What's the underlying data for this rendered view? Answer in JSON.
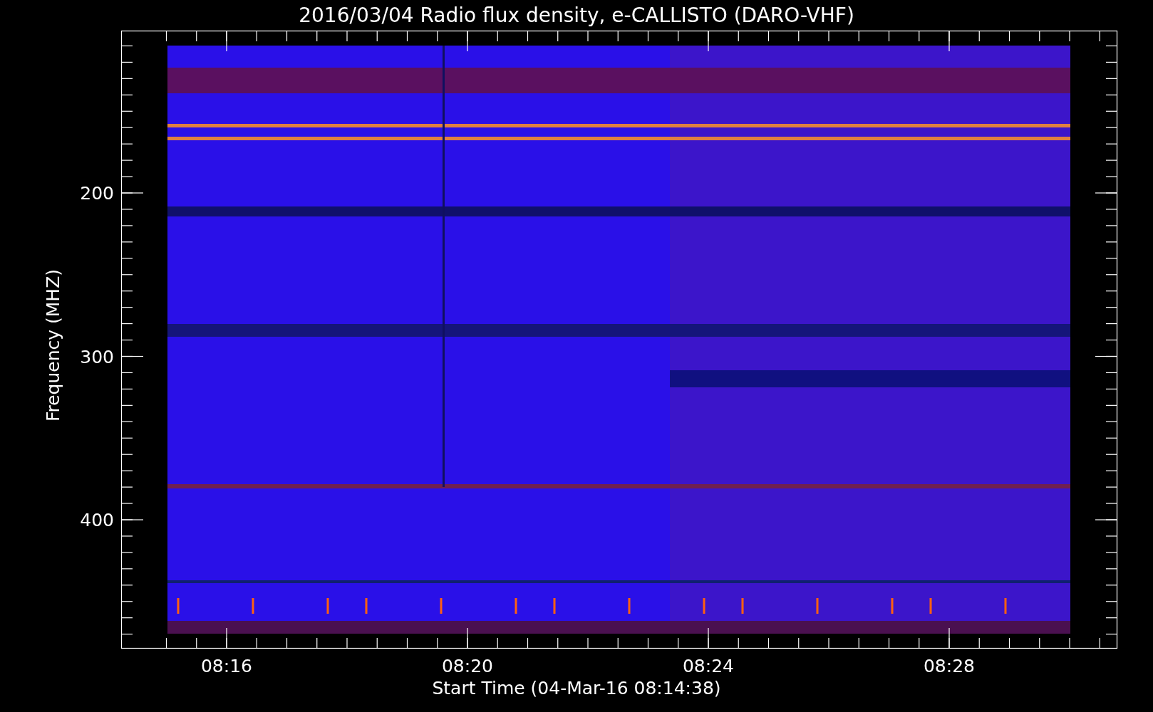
{
  "title": "2016/03/04  Radio flux density, e-CALLISTO (DARO-VHF)",
  "y_axis": {
    "label": "Frequency (MHZ)",
    "ticks": [
      "200",
      "300",
      "400"
    ]
  },
  "x_axis": {
    "label": "Start Time (04-Mar-16 08:14:38)",
    "ticks": [
      "08:16",
      "08:20",
      "08:24",
      "08:28"
    ]
  }
}
